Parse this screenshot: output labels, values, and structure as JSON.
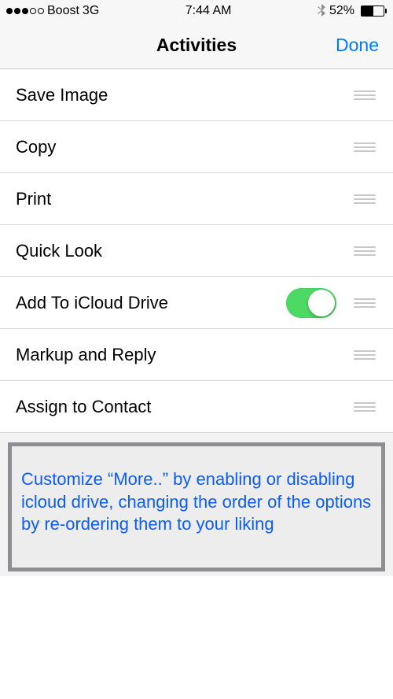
{
  "status": {
    "carrier": "Boost",
    "network": "3G",
    "time": "7:44 AM",
    "battery_pct": "52%"
  },
  "nav": {
    "title": "Activities",
    "done": "Done"
  },
  "rows": [
    {
      "label": "Save Image",
      "toggle": null
    },
    {
      "label": "Copy",
      "toggle": null
    },
    {
      "label": "Print",
      "toggle": null
    },
    {
      "label": "Quick Look",
      "toggle": null
    },
    {
      "label": "Add To iCloud Drive",
      "toggle": true
    },
    {
      "label": "Markup and Reply",
      "toggle": null
    },
    {
      "label": "Assign to Contact",
      "toggle": null
    }
  ],
  "callout": "Customize “More..” by enabling or disabling icloud drive, changing the order of the options by re-ordering them to your liking"
}
